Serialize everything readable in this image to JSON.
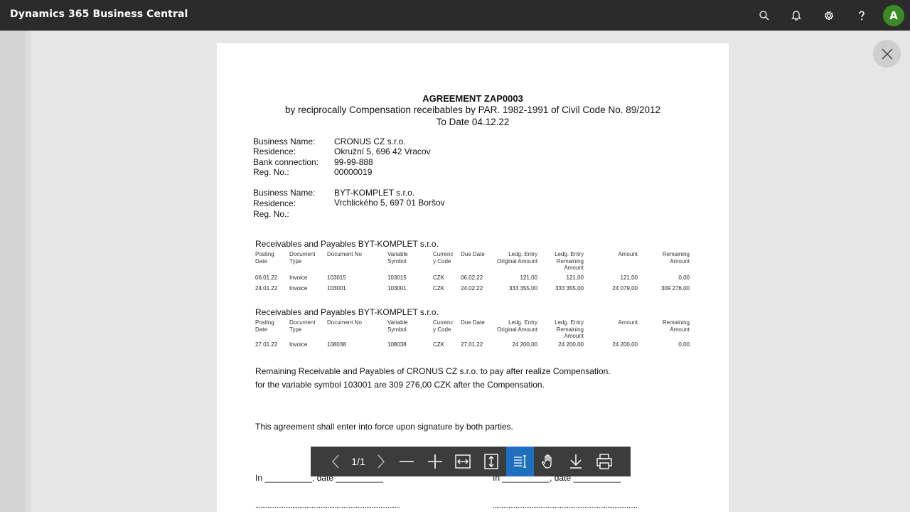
{
  "app": {
    "title": "Dynamics 365 Business Central",
    "avatar_letter": "A"
  },
  "header_icons": [
    "search-icon",
    "bell-icon",
    "gear-icon",
    "help-icon"
  ],
  "colors": {
    "topbar": "#2b2b2b",
    "avatar": "#3c8a27",
    "toolbar": "#3c3c3c",
    "toolbar_active": "#1f6fbf"
  },
  "document": {
    "title": "AGREEMENT ZAP0003",
    "subtitle": "by reciprocally Compensation receibables by PAR. 1982-1991 of Civil Code No. 89/2012",
    "date_line": "To Date 04.12.22",
    "party1": {
      "business_label": "Business Name:",
      "business": "CRONUS CZ s.r.o.",
      "residence_label": "Residence:",
      "residence": "Okružní 5, 696 42  Vracov",
      "bank_label": "Bank connection:",
      "bank": "99-99-888",
      "reg_label": "Reg. No.:",
      "reg": "00000019"
    },
    "party2": {
      "business_label": "Business Name:",
      "business": "BYT-KOMPLET s.r.o.",
      "residence_label": "Residence:",
      "residence": "Vrchlického 5, 697 01 Boršov",
      "reg_label": "Reg. No.:"
    },
    "columns": {
      "posting_date": [
        "Posting",
        "Date"
      ],
      "document_type": [
        "Document",
        "Type"
      ],
      "document_no": [
        "Document No"
      ],
      "variable_symbol": [
        "Variable",
        "Symbol"
      ],
      "currency_code": [
        "Currenc",
        "y Code"
      ],
      "due_date": [
        "Due Date"
      ],
      "orig_amount": [
        "Ledg. Entry",
        "Original Amount"
      ],
      "rem_amount": [
        "Ledg. Entry",
        "Remaining",
        "Amount"
      ],
      "amount": [
        "Amount"
      ],
      "remaining": [
        "Remaining",
        "Amount"
      ]
    },
    "sections": [
      {
        "title": "Receivables and Payables BYT-KOMPLET s.r.o.",
        "rows": [
          [
            "06.01.22",
            "Invoice",
            "103015",
            "103015",
            "CZK",
            "06.02.22",
            "121,00",
            "121,00",
            "121,00",
            "0,00"
          ],
          [
            "24.01.22",
            "Invoice",
            "103001",
            "103001",
            "CZK",
            "24.02.22",
            "333 355,00",
            "333 355,00",
            "24 079,00",
            "309 276,00"
          ]
        ]
      },
      {
        "title": "Receivables and Payables BYT-KOMPLET s.r.o.",
        "rows": [
          [
            "27.01.22",
            "Invoice",
            "108038",
            "108038",
            "CZK",
            "27.01.22",
            "24 200,00",
            "24 200,00",
            "24 200,00",
            "0,00"
          ]
        ]
      }
    ],
    "remaining_line1": "Remaining Receivable and Payables of CRONUS CZ s.r.o. to pay after realize Compensation.",
    "remaining_line2": "for the variable symbol 103001 are 309 276,00 CZK after the Compensation.",
    "force_line": "This agreement shall enter into force upon signature by both parties.",
    "sign_left": "In __________, date __________",
    "sign_right": "In __________, date __________",
    "dots_left": "..................................................................................",
    "dots_right": ".................................................................................."
  },
  "viewer": {
    "page_count": "1/1"
  }
}
